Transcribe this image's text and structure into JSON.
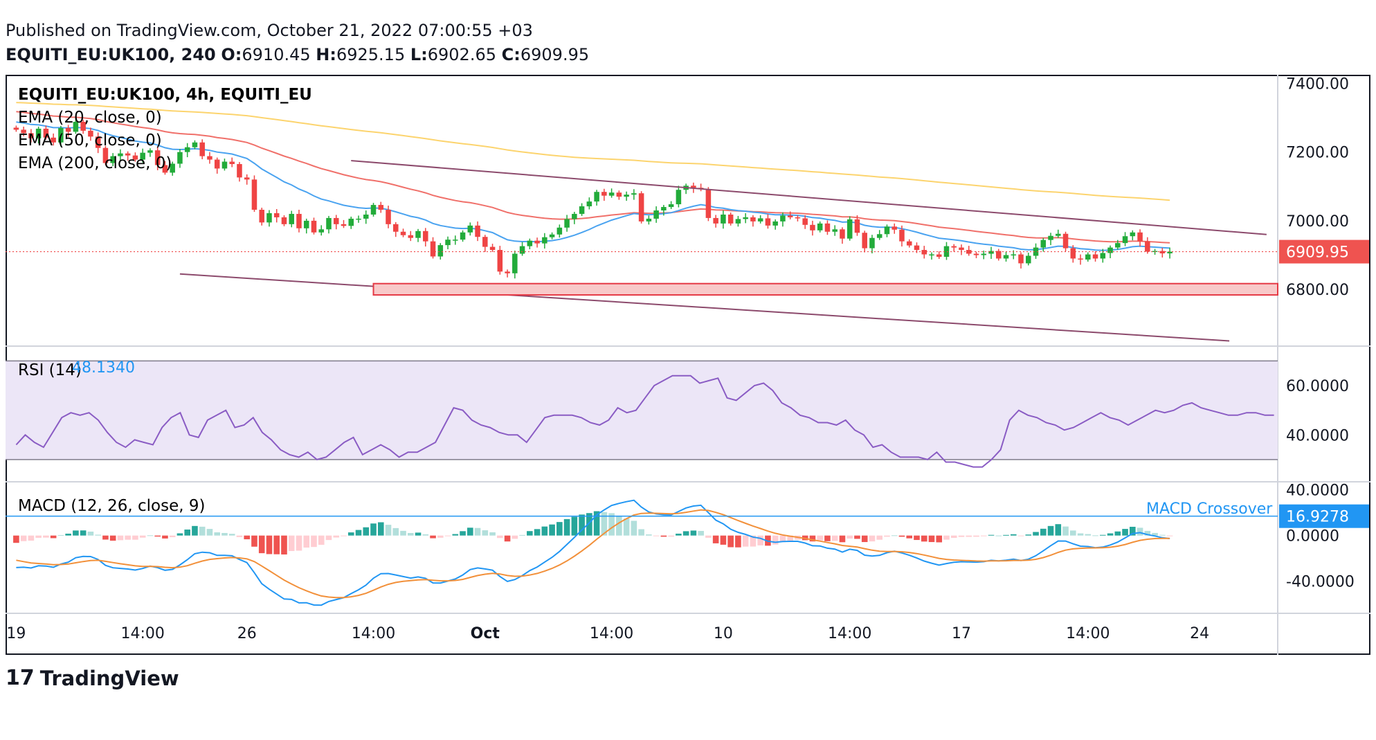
{
  "header": {
    "published": "Published on TradingView.com, October 21, 2022 07:00:55 +03",
    "symbol_interval": "EQUITI_EU:UK100, 240",
    "o_label": "O:",
    "o_value": "6910.45",
    "h_label": "H:",
    "h_value": "6925.15",
    "l_label": "L:",
    "l_value": "6902.65",
    "c_label": "C:",
    "c_value": "6909.95"
  },
  "legend": {
    "title": "EQUITI_EU:UK100, 4h, EQUITI_EU",
    "ema20": "EMA (20, close, 0)",
    "ema50": "EMA (50, close, 0)",
    "ema200": "EMA (200, close, 0)",
    "rsi": "RSI (14)",
    "rsi_value": "48.1340",
    "macd": "MACD (12, 26, close, 9)",
    "macd_annotation": "MACD Crossover"
  },
  "brand": {
    "name": "TradingView",
    "logo_text": "17"
  },
  "colors": {
    "up": "#22ab3a",
    "down": "#ef4444",
    "ema20": "#4aa3f0",
    "ema50": "#f0706a",
    "ema200": "#fcd46e",
    "trendline": "#8c4a6c",
    "support_fill": "#f8c9c9",
    "support_stroke": "#e53945",
    "rsi": "#8a5cc4",
    "rsi_band": "#ece6f7",
    "macd": "#2196f3",
    "signal": "#f2903a",
    "hist_up_strong": "#26a69a",
    "hist_up_weak": "#b2dfdb",
    "hist_down_strong": "#ef5350",
    "hist_down_weak": "#ffcdd2",
    "price_label_bg": "#ef5350",
    "macd_label_bg": "#2196f3"
  },
  "chart_data": {
    "type": "candlestick",
    "interval": "4h",
    "x_ticks": [
      "19",
      "14:00",
      "26",
      "14:00",
      "Oct",
      "14:00",
      "10",
      "14:00",
      "17",
      "14:00",
      "24"
    ],
    "x_tick_bars": [
      0,
      17,
      31,
      48,
      63,
      80,
      95,
      112,
      127,
      144,
      159
    ],
    "total_bars": 170,
    "price": {
      "yticks": [
        "7400.00",
        "7200.00",
        "7000.00",
        "6800.00"
      ],
      "ylim": [
        6635,
        7425
      ],
      "last_price": "6909.95",
      "closes": [
        7265,
        7255,
        7240,
        7268,
        7242,
        7228,
        7270,
        7259,
        7288,
        7262,
        7245,
        7212,
        7168,
        7188,
        7196,
        7190,
        7178,
        7198,
        7205,
        7162,
        7140,
        7166,
        7200,
        7214,
        7228,
        7188,
        7178,
        7152,
        7172,
        7165,
        7126,
        7120,
        7032,
        6995,
        7022,
        7010,
        6990,
        7020,
        6978,
        7000,
        6966,
        6975,
        7008,
        6990,
        6985,
        7006,
        7006,
        7018,
        7046,
        7032,
        6990,
        6968,
        6958,
        6950,
        6970,
        6940,
        6896,
        6929,
        6945,
        6945,
        6966,
        6986,
        6953,
        6924,
        6915,
        6852,
        6847,
        6904,
        6926,
        6942,
        6934,
        6952,
        6960,
        6980,
        7005,
        7020,
        7042,
        7056,
        7084,
        7073,
        7082,
        7070,
        7076,
        7080,
        6998,
        7006,
        7030,
        7040,
        7048,
        7090,
        7102,
        7096,
        7092,
        7008,
        6992,
        7018,
        6992,
        7005,
        7010,
        6998,
        7007,
        6986,
        6998,
        7015,
        7010,
        7007,
        6988,
        6972,
        6992,
        6968,
        6975,
        6948,
        7004,
        6965,
        6920,
        6950,
        6961,
        6983,
        6974,
        6940,
        6928,
        6915,
        6902,
        6902,
        6895,
        6926,
        6922,
        6915,
        6904,
        6900,
        6904,
        6912,
        6890,
        6900,
        6902,
        6876,
        6898,
        6922,
        6944,
        6956,
        6962,
        6920,
        6890,
        6887,
        6902,
        6890,
        6906,
        6922,
        6935,
        6955,
        6966,
        6940,
        6910,
        6912,
        6905,
        6910
      ],
      "ema20_start": 7290,
      "ema50_start": 7320,
      "ema200_start": 7345
    },
    "rsi": {
      "yticks": [
        "60.0000",
        "40.0000"
      ],
      "ylim": [
        21,
        76
      ],
      "value": "48.1340",
      "values": [
        36,
        40,
        37,
        35,
        41,
        47,
        49,
        48,
        49,
        46,
        41,
        37,
        35,
        38,
        37,
        36,
        43,
        47,
        49,
        40,
        39,
        46,
        48,
        50,
        43,
        44,
        47,
        41,
        38,
        34,
        32,
        31,
        33,
        30,
        31,
        34,
        37,
        39,
        32,
        34,
        36,
        34,
        31,
        33,
        33,
        35,
        37,
        44,
        51,
        50,
        46,
        44,
        43,
        41,
        40,
        40,
        37,
        42,
        47,
        48,
        48,
        48,
        47,
        45,
        44,
        46,
        51,
        49,
        50,
        55,
        60,
        62,
        64,
        64,
        64,
        61,
        62,
        63,
        55,
        54,
        57,
        60,
        61,
        58,
        53,
        51,
        48,
        47,
        45,
        45,
        44,
        46,
        42,
        40,
        35,
        36,
        33,
        31,
        31,
        31,
        30,
        33,
        29,
        29,
        28,
        27,
        27,
        30,
        34,
        46,
        50,
        48,
        47,
        45,
        44,
        42,
        43,
        45,
        47,
        49,
        47,
        46,
        44,
        46,
        48,
        50,
        49,
        50,
        52,
        53,
        51,
        50,
        49,
        48,
        48,
        49,
        49,
        48,
        48
      ]
    },
    "macd": {
      "yticks": [
        "40.0000",
        "0.0000",
        "-40.0000"
      ],
      "ylim": [
        -68,
        47
      ],
      "value": "16.9278",
      "annotation": "MACD Crossover",
      "macd_start": -28,
      "signal_start": -20
    }
  }
}
